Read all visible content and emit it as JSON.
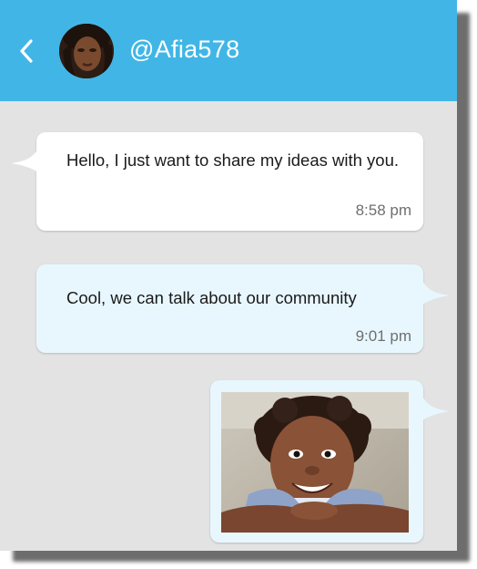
{
  "header": {
    "username": "@Afia578",
    "back_icon": "chevron-left-icon",
    "background": "#41b6e6"
  },
  "messages": [
    {
      "direction": "incoming",
      "text": "Hello, I just want to share my ideas with you.",
      "time": "8:58 pm"
    },
    {
      "direction": "outgoing",
      "text": "Cool, we can talk about our community",
      "time": "9:01 pm"
    },
    {
      "direction": "outgoing",
      "type": "image",
      "image": "photo of a smiling child"
    }
  ],
  "colors": {
    "chat_background": "#e3e3e3",
    "incoming_bubble": "#ffffff",
    "outgoing_bubble": "#e8f7fe"
  }
}
